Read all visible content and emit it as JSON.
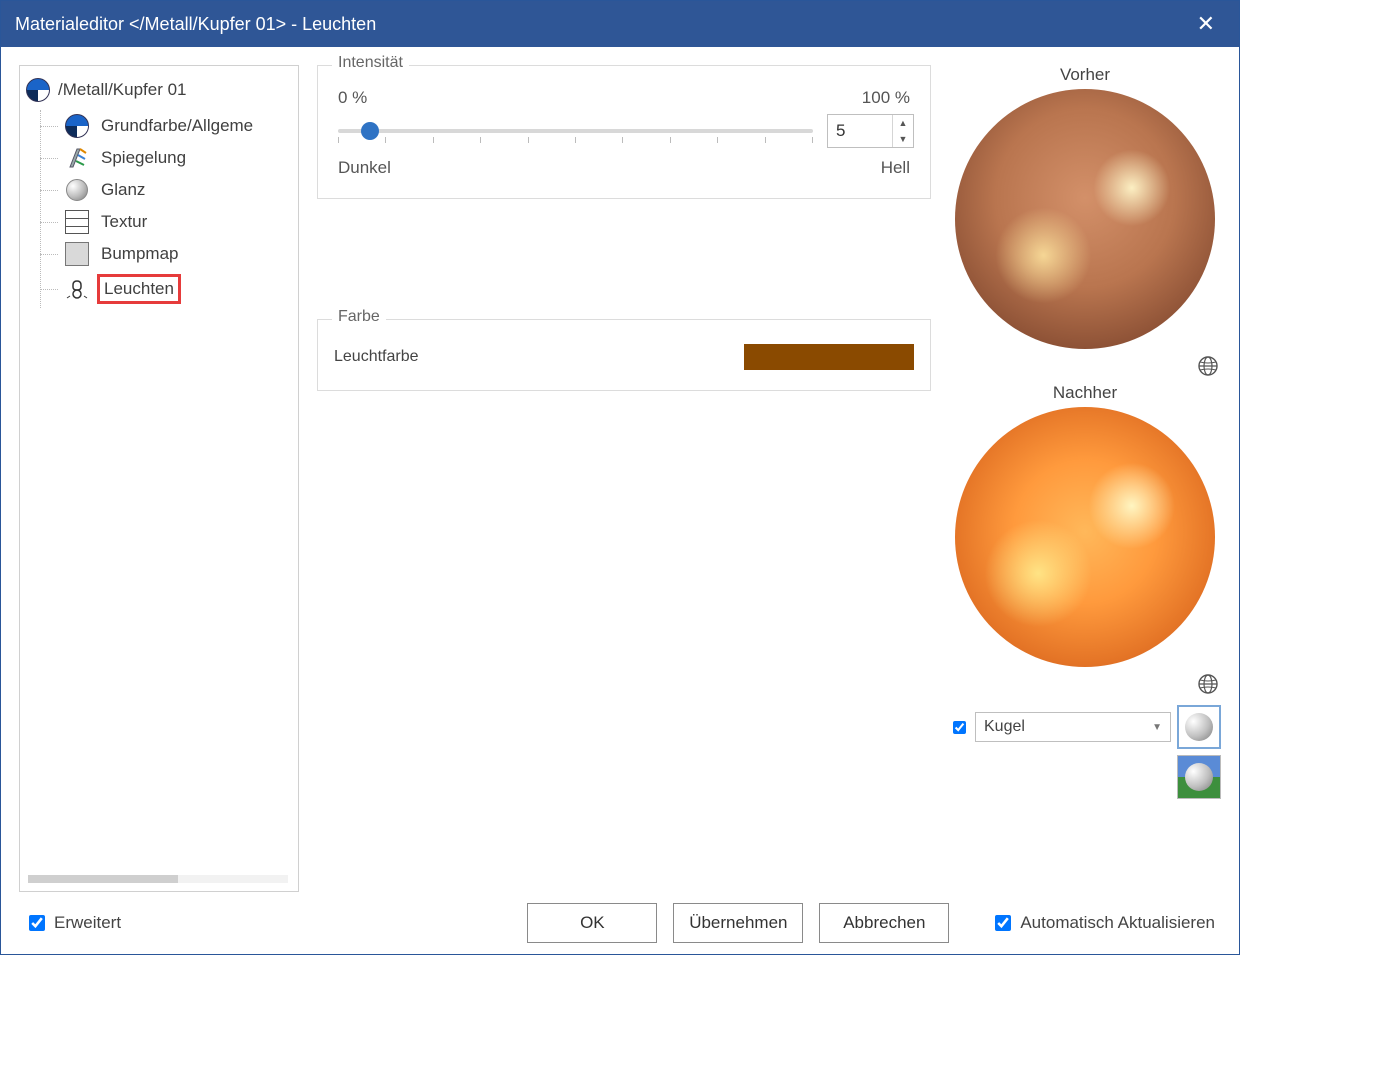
{
  "title": "Materialeditor   </Metall/Kupfer 01>  - Leuchten",
  "tree": {
    "root": "/Metall/Kupfer 01",
    "items": [
      {
        "label": "Grundfarbe/Allgeme"
      },
      {
        "label": "Spiegelung"
      },
      {
        "label": "Glanz"
      },
      {
        "label": "Textur"
      },
      {
        "label": "Bumpmap"
      },
      {
        "label": "Leuchten"
      }
    ],
    "selected_index": 5
  },
  "intensity": {
    "legend": "Intensität",
    "min_label": "0 %",
    "max_label": "100 %",
    "dark_label": "Dunkel",
    "light_label": "Hell",
    "value": "5",
    "slider_percent": 5
  },
  "color_section": {
    "legend": "Farbe",
    "label": "Leuchtfarbe",
    "swatch_hex": "#8a4a00"
  },
  "preview": {
    "before_title": "Vorher",
    "after_title": "Nachher",
    "shape_checked": true,
    "shape_value": "Kugel"
  },
  "footer": {
    "extended_label": "Erweitert",
    "extended_checked": true,
    "ok": "OK",
    "apply": "Übernehmen",
    "cancel": "Abbrechen",
    "auto_label": "Automatisch Aktualisieren",
    "auto_checked": true
  }
}
